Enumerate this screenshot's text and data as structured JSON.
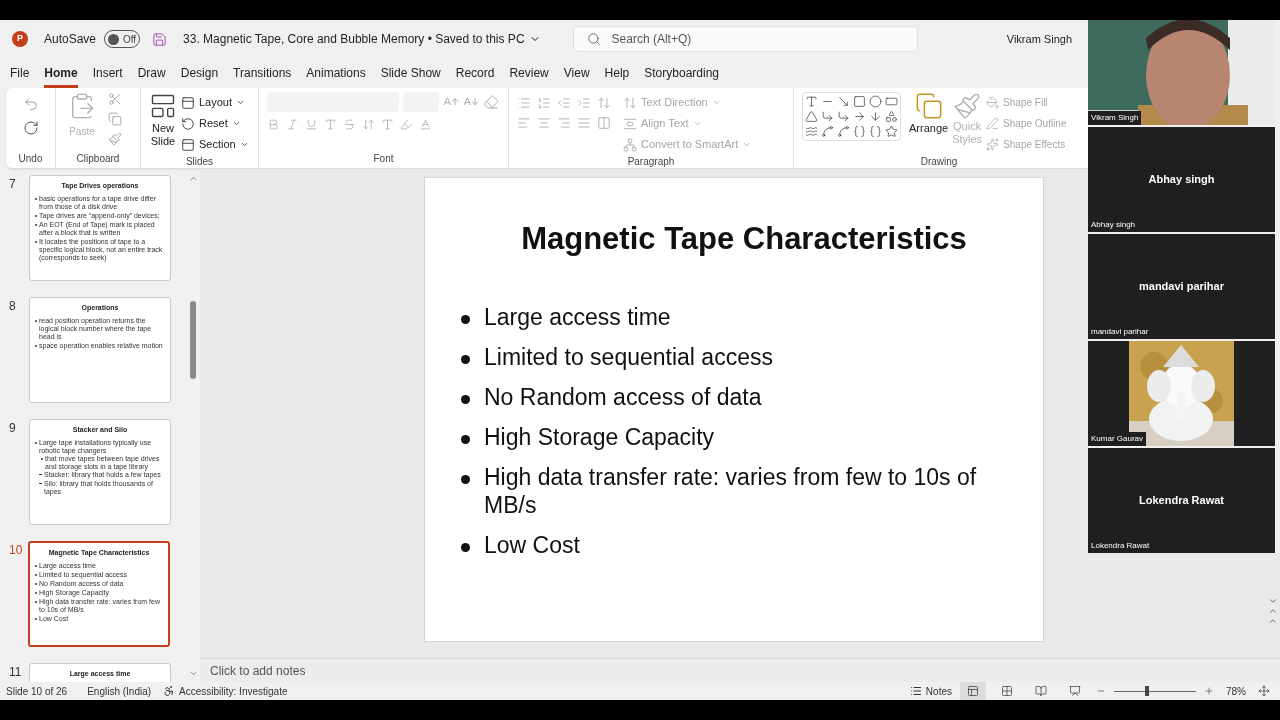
{
  "title_bar": {
    "app_logo_letter": "P",
    "autosave_label": "AutoSave",
    "autosave": {
      "on": false,
      "label": "Off"
    },
    "document_title": "33. Magnetic Tape, Core and Bubble Memory • Saved to this PC",
    "search_placeholder": "Search (Alt+Q)",
    "user": "Vikram Singh"
  },
  "tabs": [
    {
      "label": "File",
      "selected": false
    },
    {
      "label": "Home",
      "selected": true
    },
    {
      "label": "Insert",
      "selected": false
    },
    {
      "label": "Draw",
      "selected": false
    },
    {
      "label": "Design",
      "selected": false
    },
    {
      "label": "Transitions",
      "selected": false
    },
    {
      "label": "Animations",
      "selected": false
    },
    {
      "label": "Slide Show",
      "selected": false
    },
    {
      "label": "Record",
      "selected": false
    },
    {
      "label": "Review",
      "selected": false
    },
    {
      "label": "View",
      "selected": false
    },
    {
      "label": "Help",
      "selected": false
    },
    {
      "label": "Storyboarding",
      "selected": false
    }
  ],
  "ribbon": {
    "group_labels": [
      "Undo",
      "Clipboard",
      "Slides",
      "Font",
      "Paragraph",
      "Drawing"
    ],
    "paste": {
      "label": "Paste",
      "disabled": true
    },
    "new_slide": {
      "label_lines": [
        "New",
        "Slide"
      ],
      "disabled": false
    },
    "slides_commands": [
      {
        "label": "Layout",
        "disabled": false
      },
      {
        "label": "Reset",
        "disabled": false
      },
      {
        "label": "Section",
        "disabled": false
      }
    ],
    "paragraph_commands": [
      {
        "label": "Text Direction",
        "disabled": true
      },
      {
        "label": "Align Text",
        "disabled": true
      },
      {
        "label": "Convert to SmartArt",
        "disabled": true
      }
    ],
    "arrange": {
      "label": "Arrange",
      "disabled": false
    },
    "quick_styles": {
      "label_lines": [
        "Quick",
        "Styles"
      ],
      "disabled": true
    },
    "shape_commands": [
      {
        "label": "Shape Fill",
        "disabled": true
      },
      {
        "label": "Shape Outline",
        "disabled": true
      },
      {
        "label": "Shape Effects",
        "disabled": true
      }
    ]
  },
  "thumbnails": [
    {
      "number": "7",
      "selected": false,
      "title": "Tape Drives operations",
      "bullets": [
        {
          "text": "basic operations for a tape drive differ from those of a disk drive"
        },
        {
          "text": "Tape drives are “append-only” devices;"
        },
        {
          "text": "An EOT (End of Tape) mark is placed after a block that is written"
        },
        {
          "text": "It locates the positions of tape to a specific logical block, not an entire track (corresponds to seek)"
        }
      ]
    },
    {
      "number": "8",
      "selected": false,
      "title": "Operations",
      "bullets": [
        {
          "text": "read position operation returns the logical block number where the tape head is"
        },
        {
          "text": "space operation enables relative motion"
        }
      ]
    },
    {
      "number": "9",
      "selected": false,
      "title": "Stacker and Silo",
      "bullets": [
        {
          "text": "Large tape installations typically use robotic tape changers",
          "children": [
            {
              "text": "that move tapes between tape drives and storage slots in a tape library",
              "children": [
                {
                  "text": "Stacker: library that holds a few tapes"
                },
                {
                  "text": "Silo: library that holds thousands of tapes"
                }
              ]
            }
          ]
        }
      ]
    },
    {
      "number": "10",
      "selected": true,
      "title": "Magnetic Tape Characteristics",
      "bullets": [
        {
          "text": "Large access time"
        },
        {
          "text": "Limited to sequential access"
        },
        {
          "text": "No Random access of data"
        },
        {
          "text": "High Storage Capacity"
        },
        {
          "text": "High data transfer rate: varies from few to 10s of MB/s"
        },
        {
          "text": "Low Cost"
        }
      ]
    },
    {
      "number": "11",
      "selected": false,
      "title": "Large access time"
    }
  ],
  "slide": {
    "title": "Magnetic Tape Characteristics",
    "bullets": [
      "Large access time",
      "Limited to sequential access",
      "No Random access of data",
      "High Storage Capacity",
      "High data transfer rate: varies from few to 10s of MB/s",
      "Low Cost"
    ]
  },
  "notes_placeholder": "Click to add notes",
  "status_bar": {
    "slide_info": "Slide 10 of 26",
    "language": "English (India)",
    "accessibility": "Accessibility: Investigate",
    "notes": "Notes",
    "views": [
      {
        "kind": "normal",
        "selected": true
      },
      {
        "kind": "sorter",
        "selected": false
      },
      {
        "kind": "reading",
        "selected": false
      },
      {
        "kind": "slideshow",
        "selected": false
      }
    ],
    "zoom": {
      "level": 0.4,
      "reading": "78%"
    }
  },
  "participants": [
    {
      "kind": "camera",
      "name": "Vikram Singh"
    },
    {
      "kind": "name",
      "center_label": "Abhay singh",
      "name": "Abhay singh"
    },
    {
      "kind": "name",
      "center_label": "mandavi parihar",
      "name": "mandavi parihar"
    },
    {
      "kind": "picture",
      "name": "Kumar Gaurav"
    },
    {
      "kind": "name",
      "center_label": "Lokendra Rawat",
      "name": "Lokendra Rawat"
    }
  ]
}
